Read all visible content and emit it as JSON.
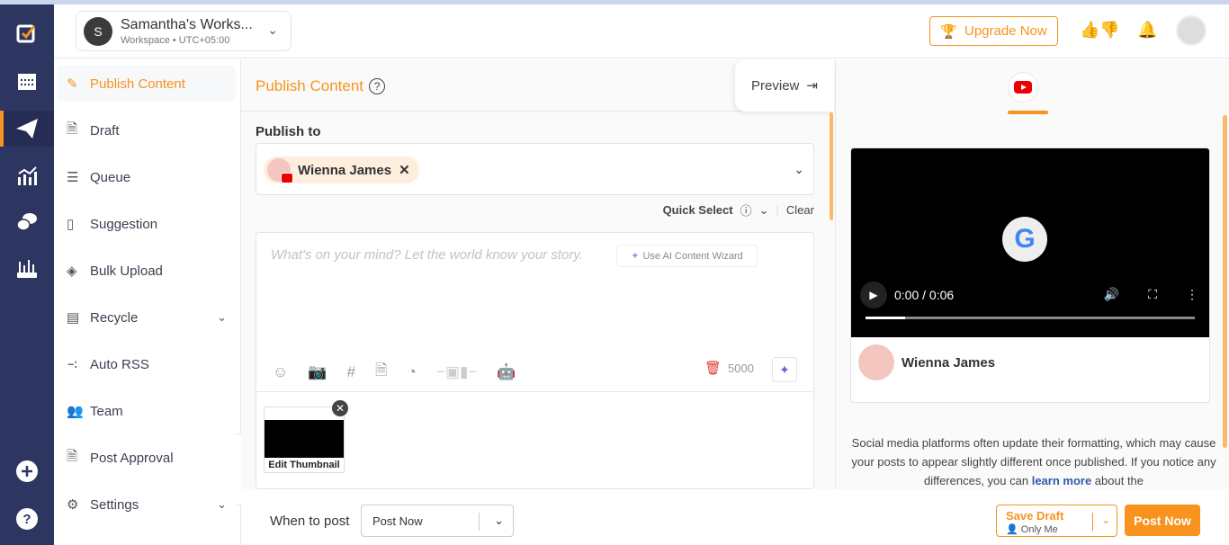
{
  "header": {
    "workspace_initial": "S",
    "workspace_name": "Samantha's Works...",
    "workspace_sub": "Workspace • UTC+05:00",
    "upgrade_label": "Upgrade Now"
  },
  "sidebar": {
    "items": [
      {
        "label": "Publish Content",
        "icon": "pencil-icon"
      },
      {
        "label": "Draft",
        "icon": "document-icon"
      },
      {
        "label": "Queue",
        "icon": "list-icon"
      },
      {
        "label": "Suggestion",
        "icon": "bookmark-icon"
      },
      {
        "label": "Bulk Upload",
        "icon": "layers-icon"
      },
      {
        "label": "Recycle",
        "icon": "archive-icon"
      },
      {
        "label": "Auto RSS",
        "icon": "rss-icon"
      },
      {
        "label": "Team",
        "icon": "team-icon"
      },
      {
        "label": "Post Approval",
        "icon": "approval-icon"
      },
      {
        "label": "Settings",
        "icon": "gear-icon"
      }
    ]
  },
  "main": {
    "title": "Publish Content",
    "preview_label": "Preview",
    "publish_to_label": "Publish to",
    "selected_account": "Wienna James",
    "quick_select": "Quick Select",
    "clear": "Clear",
    "placeholder": "What's on your mind? Let the world know your story.",
    "ai_wizard": "Use AI Content Wizard",
    "char_count": "5000",
    "edit_thumbnail": "Edit Thumbnail"
  },
  "preview": {
    "platform": "YouTube",
    "time": "0:00 / 0:06",
    "progress": 0.12,
    "account": "Wienna James",
    "note_1": "Social media platforms often update their formatting, which may cause your posts to appear slightly different once published. If you notice any differences, you can ",
    "note_link": "learn more",
    "note_2": " about the"
  },
  "footer": {
    "when_label": "When to post",
    "when_value": "Post Now",
    "save_draft": "Save Draft",
    "visibility": "Only Me",
    "post_now": "Post Now"
  },
  "colors": {
    "accent": "#f7931e",
    "rail": "#2d3561",
    "youtube": "#ff0000"
  }
}
